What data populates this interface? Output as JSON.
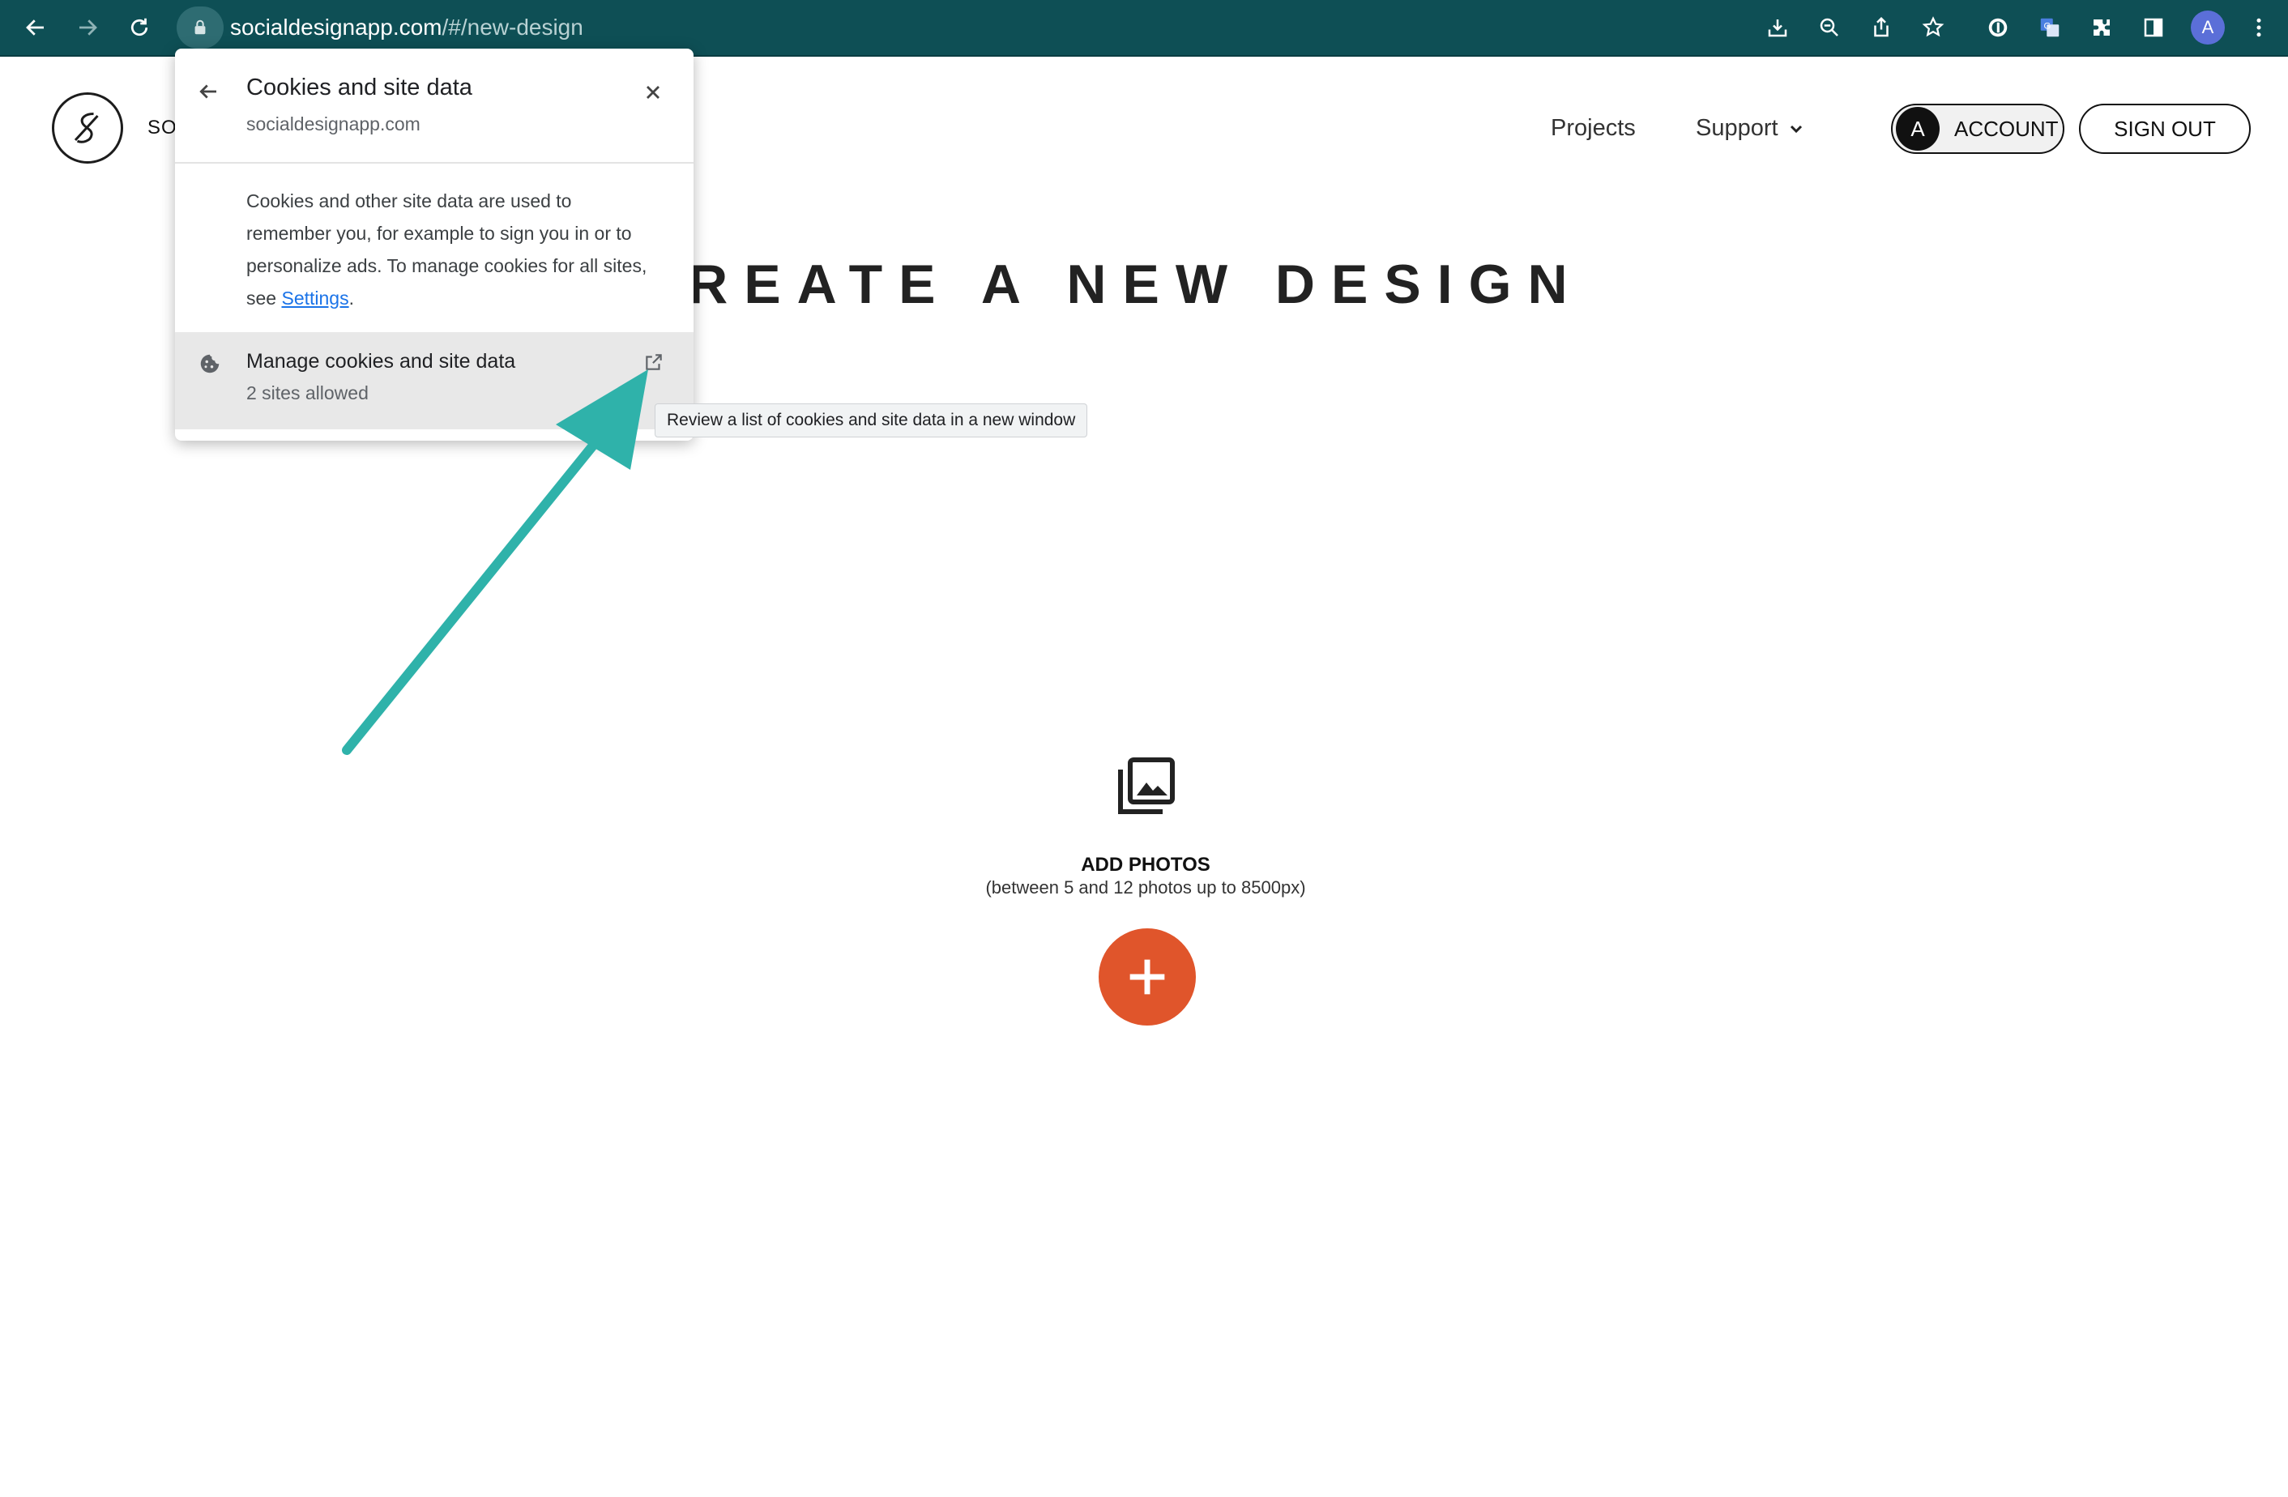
{
  "browser": {
    "url_host": "socialdesignapp.com",
    "url_path": "/#/new-design",
    "profile_initial": "A",
    "icons": [
      "back-icon",
      "forward-icon",
      "reload-icon",
      "lock-icon",
      "install-icon",
      "zoom-icon",
      "share-icon",
      "bookmark-star-icon",
      "password-manager-icon",
      "translate-icon",
      "extensions-icon",
      "side-panel-icon",
      "profile-avatar",
      "more-menu-icon"
    ]
  },
  "site": {
    "brand_partial": "SO",
    "nav": {
      "projects": "Projects",
      "support": "Support"
    },
    "account_initial": "A",
    "account_label": "ACCOUNT",
    "signout_label": "SIGN OUT",
    "page_title": "CREATE A NEW DESIGN",
    "add_photos": {
      "title": "ADD PHOTOS",
      "subtitle": "(between 5 and 12 photos up to 8500px)"
    },
    "accent_color": "#e0552b"
  },
  "popup": {
    "title": "Cookies and site data",
    "domain": "socialdesignapp.com",
    "description_before": "Cookies and other site data are used to remember you, for example to sign you in or to personalize ads. To manage cookies for all sites, see ",
    "settings_link": "Settings",
    "description_after": ".",
    "manage_title": "Manage cookies and site data",
    "manage_sub": "2 sites allowed",
    "tooltip": "Review a list of cookies and site data in a new window"
  },
  "annotation": {
    "arrow_color": "#2fb2aa"
  }
}
